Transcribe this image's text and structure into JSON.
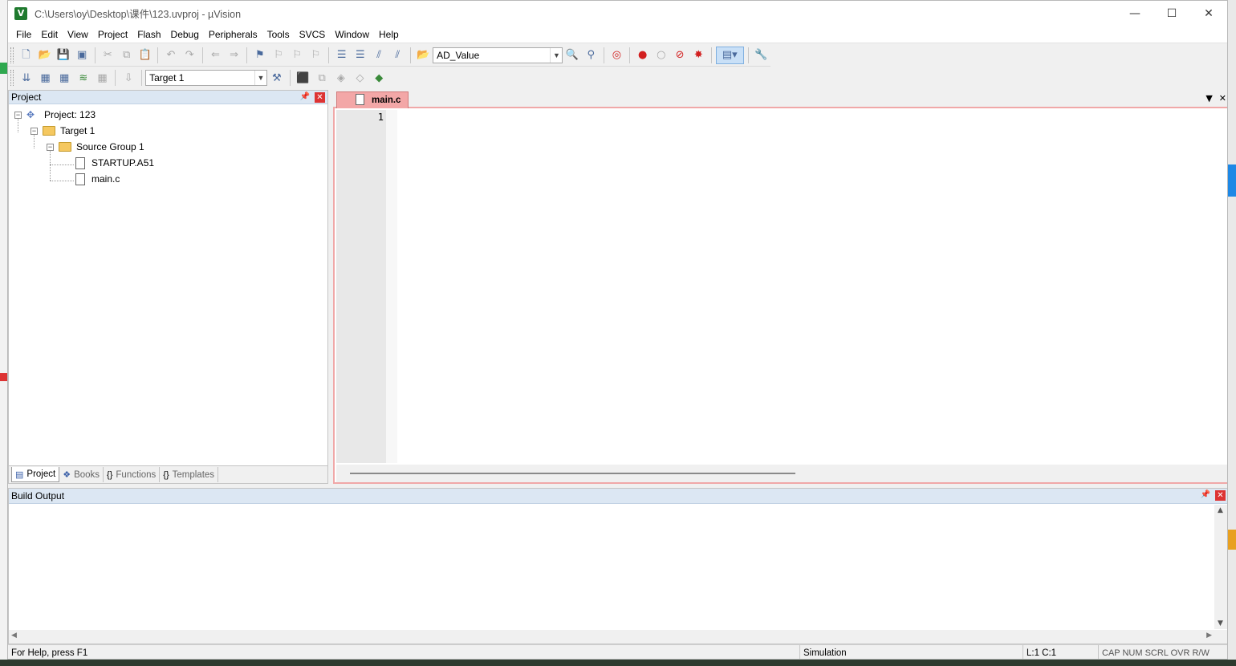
{
  "window": {
    "title": "C:\\Users\\oy\\Desktop\\课件\\123.uvproj - µVision",
    "app_icon": "V",
    "controls": [
      "—",
      "☐",
      "✕"
    ]
  },
  "menu": [
    "File",
    "Edit",
    "View",
    "Project",
    "Flash",
    "Debug",
    "Peripherals",
    "Tools",
    "SVCS",
    "Window",
    "Help"
  ],
  "toolbar": {
    "find_combo_value": "AD_Value",
    "target_combo_value": "Target 1"
  },
  "project_pane": {
    "title": "Project",
    "pin": "📌",
    "close": "✕",
    "tree": {
      "project": "Project: 123",
      "target": "Target 1",
      "group": "Source Group 1",
      "files": [
        "STARTUP.A51",
        "main.c"
      ]
    },
    "tabs": [
      "Project",
      "Books",
      "Functions",
      "Templates"
    ]
  },
  "editor": {
    "active_tab": "main.c",
    "line_numbers": [
      "1"
    ],
    "content": ""
  },
  "build_output": {
    "title": "Build Output",
    "content": ""
  },
  "statusbar": {
    "help": "For Help, press F1",
    "mode": "Simulation",
    "position": "L:1 C:1",
    "indicators": "CAP NUM SCRL OVR R/W"
  }
}
